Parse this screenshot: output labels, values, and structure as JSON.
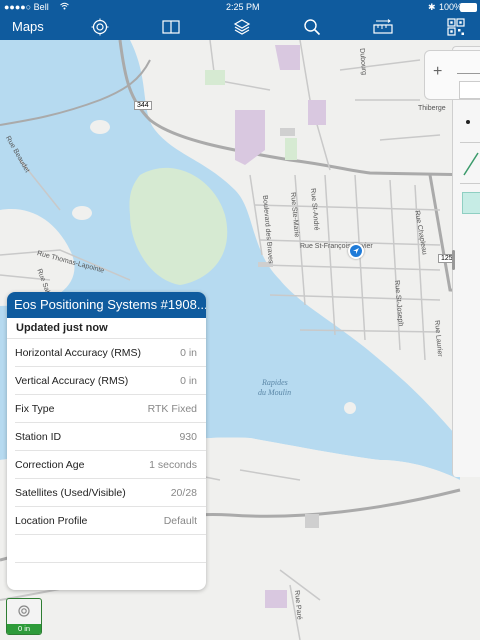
{
  "status": {
    "carrier": "●●●●○ Bell",
    "time": "2:25 PM",
    "battery": "100%"
  },
  "nav": {
    "title": "Maps",
    "icons": [
      "gps-target-icon",
      "book-icon",
      "layers-icon",
      "search-icon",
      "measure-ruler-icon",
      "qr-grid-icon"
    ]
  },
  "map": {
    "labels": {
      "route_344": "344",
      "route_125": "125",
      "rapides": "Rapides",
      "moulin": "du Moulin",
      "rue_st_francois_xavier": "Rue St-François-Xavier",
      "rue_chapleau": "Rue Chapleau",
      "rue_beaudet": "Rue Beaudet",
      "rue_thiberge": "Thiberge",
      "rue_st_andre": "Rue St-André",
      "rue_ste_marie": "Rue Ste-Marie",
      "boulevard_des_braves": "Boulevard des Braves",
      "rue_st_joseph": "Rue St-Joseph",
      "rue_laurier": "Rue Laurier",
      "rue_thomas_lapointe": "Rue Thomas-Lapointe",
      "rue_sabourin": "Rue Sabourin",
      "rue_pare": "Rue Paré",
      "rue_bisbourg": "Dubourg"
    }
  },
  "panel": {
    "title": "Eos Positioning Systems #1908...",
    "updated": "Updated just now",
    "rows": [
      {
        "label": "Horizontal Accuracy (RMS)",
        "value": "0 in"
      },
      {
        "label": "Vertical Accuracy (RMS)",
        "value": "0 in"
      },
      {
        "label": "Fix Type",
        "value": "RTK Fixed"
      },
      {
        "label": "Station ID",
        "value": "930"
      },
      {
        "label": "Correction Age",
        "value": "1 seconds"
      },
      {
        "label": "Satellites (Used/Visible)",
        "value": "20/28"
      },
      {
        "label": "Location Profile",
        "value": "Default"
      }
    ]
  },
  "gps_button": {
    "accuracy": "0 in",
    "status_color": "#2e9b3a"
  },
  "colors": {
    "brand": "#0f5b9e",
    "water": "#b6daf0",
    "park": "#d3ecd0"
  }
}
